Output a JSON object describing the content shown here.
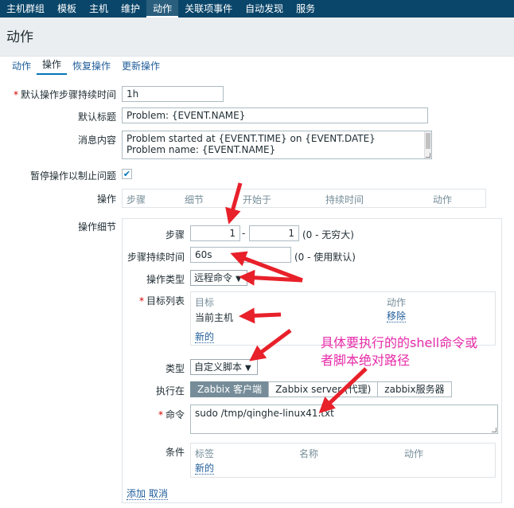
{
  "topnav": {
    "items": [
      "主机群组",
      "模板",
      "主机",
      "维护",
      "动作",
      "关联项事件",
      "自动发现",
      "服务"
    ]
  },
  "page": {
    "title": "动作"
  },
  "tabs": [
    "动作",
    "操作",
    "恢复操作",
    "更新操作"
  ],
  "form": {
    "default_duration": {
      "label": "默认操作步骤持续时间",
      "value": "1h"
    },
    "default_subject": {
      "label": "默认标题",
      "value": "Problem: {EVENT.NAME}"
    },
    "message": {
      "label": "消息内容",
      "lines": [
        "Problem started at {EVENT.TIME} on {EVENT.DATE}",
        "Problem name: {EVENT.NAME}"
      ]
    },
    "pause": {
      "label": "暂停操作以制止问题",
      "checked_mark": "✔"
    },
    "operations": {
      "label": "操作",
      "headers": [
        "步骤",
        "细节",
        "开始于",
        "持续时间",
        "动作"
      ]
    },
    "op_details": {
      "label": "操作细节",
      "steps": {
        "label": "步骤",
        "from": "1",
        "sep": "-",
        "to": "1",
        "hint": "(0 - 无穷大)"
      },
      "step_duration": {
        "label": "步骤持续时间",
        "value": "60s",
        "hint": "(0 - 使用默认)"
      },
      "op_type": {
        "label": "操作类型",
        "value": "远程命令"
      },
      "targets": {
        "label": "目标列表",
        "headers": [
          "目标",
          "动作"
        ],
        "row_target": "当前主机",
        "row_action": "移除",
        "new_link": "新的"
      },
      "type": {
        "label": "类型",
        "value": "自定义脚本"
      },
      "execute_on": {
        "label": "执行在",
        "options": [
          "Zabbix 客户端",
          "Zabbix server (代理)",
          "zabbix服务器"
        ]
      },
      "command": {
        "label": "命令",
        "value": "sudo /tmp/qinghe-linux41.txt"
      },
      "conditions": {
        "label": "条件",
        "headers": [
          "标签",
          "名称",
          "动作"
        ],
        "new_link": "新的"
      },
      "add_link": "添加",
      "cancel_link": "取消"
    }
  },
  "annotation": {
    "line1": "具体要执行的的shell命令或",
    "line2": "者脚本绝对路径"
  },
  "colors": {
    "annotation": "#e62ba8",
    "arrow": "#e8202a",
    "nav": "#0a466a",
    "link": "#1f5c99"
  }
}
